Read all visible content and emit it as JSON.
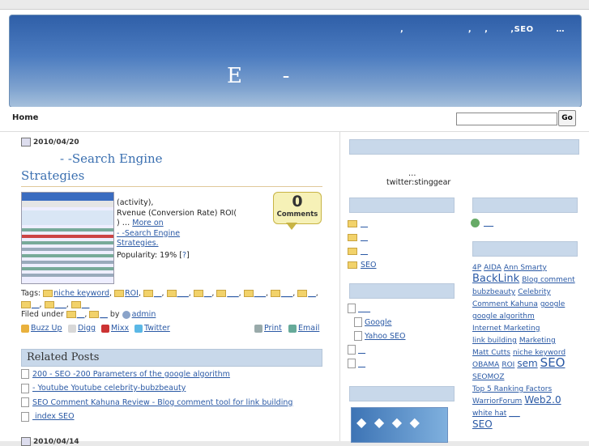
{
  "header": {
    "tagline": ",                    ,    ,       ,SEO       …",
    "site_title": "E      -"
  },
  "nav": {
    "home": "Home"
  },
  "search": {
    "placeholder": "",
    "button": "Go"
  },
  "post": {
    "date": "2010/04/20",
    "title_line1": "-                        -Search Engine",
    "title_line2": "Strategies",
    "excerpt_line1": "(activity),",
    "excerpt_line2": "Rvenue          (Conversion Rate)  ROI(",
    "excerpt_line3": ")                                   …",
    "more_link": "More on",
    "link_line1": "-                        -Search Engine",
    "link_line2": "Strategies.",
    "popularity_label": "Popularity: 19% [",
    "popularity_link": "?",
    "popularity_end": "]",
    "comments_count": "0",
    "comments_label": "Comments",
    "tags_label": "Tags:",
    "tags": [
      "niche keyword",
      "ROI",
      "__",
      "___",
      "__",
      "___",
      "___",
      "___",
      "__",
      "__",
      "___",
      "__"
    ],
    "filed_label": "Filed under",
    "filed": [
      "__",
      "__"
    ],
    "by_label": "by",
    "author": "admin",
    "share": {
      "buzz": "Buzz Up",
      "digg": "Digg",
      "mixx": "Mixx",
      "twitter": "Twitter",
      "print": "Print",
      "email": "Email"
    }
  },
  "related": {
    "heading": "Related Posts",
    "items": [
      "200        - SEO          -200 Parameters of the google algorithm",
      "- Youtube      Youtube celebrity-bubzbeauty",
      "SEO   Comment Kahuna Review - Blog comment tool for link building",
      "       index          SEO"
    ]
  },
  "next_date": "2010/04/14",
  "sidebar": {
    "about_text": "…",
    "twitter": "twitter:stinggear",
    "categories": [
      "",
      "",
      "",
      "SEO"
    ],
    "links": [
      "",
      "Google",
      "Yahoo  SEO",
      "",
      ""
    ],
    "recent": [
      ""
    ],
    "tag_cloud": [
      "4P",
      "AIDA",
      "Ann Smarty",
      "BackLink",
      "Blog comment",
      "bubzbeauty",
      "Celebrity",
      "Comment Kahuna",
      "google",
      "google algorithm",
      "Internet Marketing",
      "link building",
      "Marketing",
      "Matt Cutts",
      "niche keyword",
      "OBAMA",
      "ROI",
      "sem",
      "SEO",
      "SEOMOZ",
      "Top 5 Ranking Factors",
      "WarriorForum",
      "Web2.0",
      "white hat",
      "___",
      "SEO"
    ]
  }
}
